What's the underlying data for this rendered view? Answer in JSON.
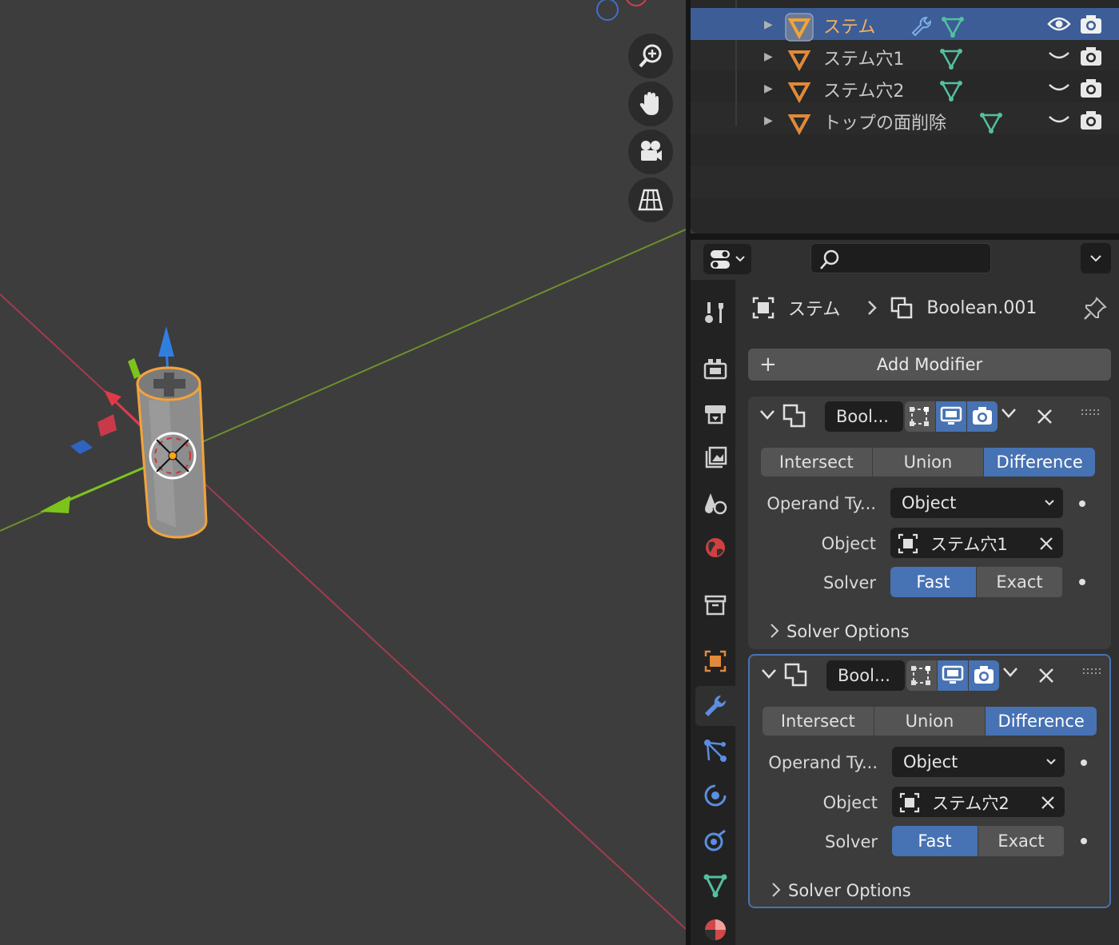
{
  "outliner": {
    "rows": [
      {
        "name": "ステム",
        "selected": true,
        "visible": true
      },
      {
        "name": "ステム穴1",
        "selected": false,
        "visible": false
      },
      {
        "name": "ステム穴2",
        "selected": false,
        "visible": false
      },
      {
        "name": "トップの面削除",
        "selected": false,
        "visible": false
      }
    ]
  },
  "properties": {
    "search_placeholder": "",
    "breadcrumb": {
      "object": "ステム",
      "modifier": "Boolean.001"
    },
    "add_modifier_label": "Add Modifier",
    "modifiers": [
      {
        "name": "Bool...",
        "operations": [
          "Intersect",
          "Union",
          "Difference"
        ],
        "active_operation": "Difference",
        "operand_type_label": "Operand Ty...",
        "operand_type_value": "Object",
        "object_label": "Object",
        "object_value": "ステム穴1",
        "solver_label": "Solver",
        "solver_options": [
          "Fast",
          "Exact"
        ],
        "active_solver": "Fast",
        "solver_options_label": "Solver Options",
        "active": false
      },
      {
        "name": "Bool...",
        "operations": [
          "Intersect",
          "Union",
          "Difference"
        ],
        "active_operation": "Difference",
        "operand_type_label": "Operand Ty...",
        "operand_type_value": "Object",
        "object_label": "Object",
        "object_value": "ステム穴2",
        "solver_label": "Solver",
        "solver_options": [
          "Fast",
          "Exact"
        ],
        "active_solver": "Fast",
        "solver_options_label": "Solver Options",
        "active": true
      }
    ]
  },
  "colors": {
    "accent": "#4772b3",
    "selection_orange": "#f7b05c",
    "mesh_green": "#53c0a0"
  }
}
